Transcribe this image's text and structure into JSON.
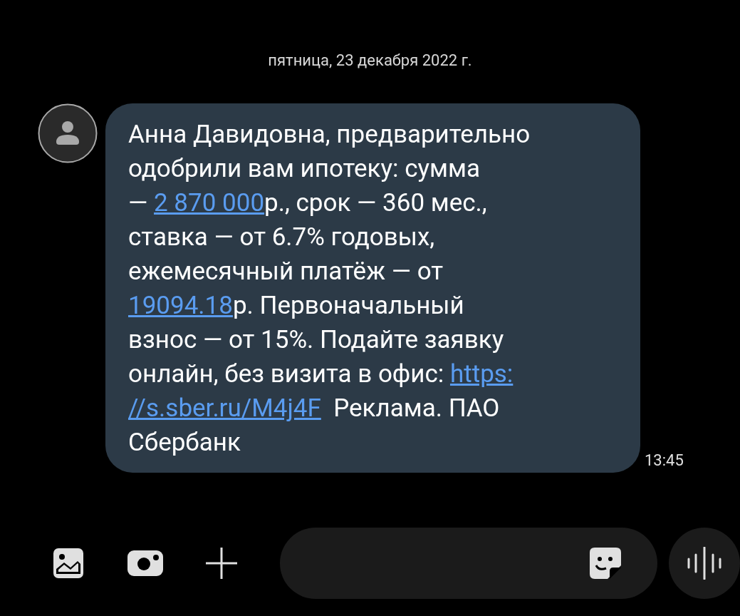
{
  "date_header": "пятница, 23 декабря 2022 г.",
  "message": {
    "lines": [
      [
        {
          "kind": "text",
          "text": "Анна Давидовна, предварительно"
        }
      ],
      [
        {
          "kind": "text",
          "text": "одобрили вам ипотеку: сумма"
        }
      ],
      [
        {
          "kind": "text",
          "text": "— "
        },
        {
          "kind": "link",
          "text": "2 870 000"
        },
        {
          "kind": "text",
          "text": "р., срок — 360 мес.,"
        }
      ],
      [
        {
          "kind": "text",
          "text": "ставка — от 6.7% годовых,"
        }
      ],
      [
        {
          "kind": "text",
          "text": "ежемесячный платёж — от"
        }
      ],
      [
        {
          "kind": "link",
          "text": "19094.18"
        },
        {
          "kind": "text",
          "text": "р. Первоначальный"
        }
      ],
      [
        {
          "kind": "text",
          "text": "взнос — от 15%. Подайте заявку"
        }
      ],
      [
        {
          "kind": "text",
          "text": "онлайн, без визита в офис: "
        },
        {
          "kind": "link",
          "text": "https:"
        }
      ],
      [
        {
          "kind": "link",
          "text": "//s.sber.ru/M4j4F"
        },
        {
          "kind": "text",
          "text": "  Реклама. ПАО"
        }
      ],
      [
        {
          "kind": "text",
          "text": "Сбербанк"
        }
      ]
    ],
    "time": "13:45"
  }
}
